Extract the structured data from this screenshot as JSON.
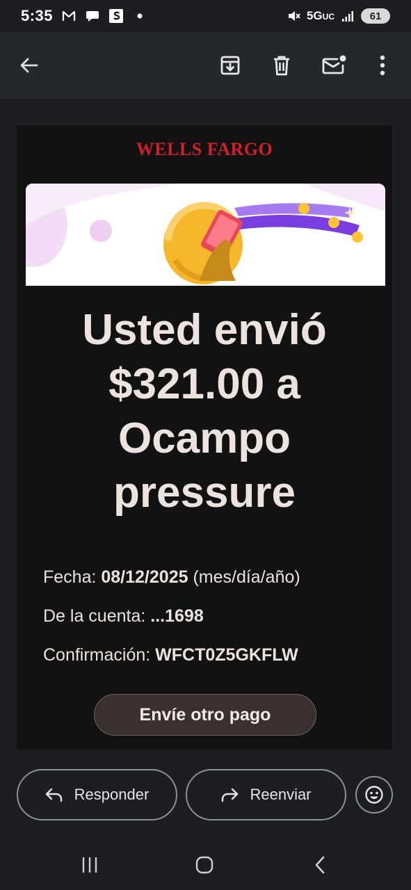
{
  "status_bar": {
    "time": "5:35",
    "network": "5G",
    "network_suffix": "UC",
    "battery": "61"
  },
  "toolbar": {
    "icons": [
      "back-arrow-icon",
      "archive-icon",
      "delete-icon",
      "mark-unread-icon",
      "more-vert-icon"
    ]
  },
  "email": {
    "brand": "WELLS FARGO",
    "headline_lines": [
      "Usted envió",
      "$321.00 a",
      "Ocampo",
      "pressure"
    ],
    "details": {
      "date_label": "Fecha: ",
      "date_value": "08/12/2025",
      "date_suffix": " (mes/día/año)",
      "account_label": "De la cuenta: ",
      "account_value": "...1698",
      "confirmation_label": "Confirmación: ",
      "confirmation_value": "WFCT0Z5GKFLW"
    },
    "cta_label": "Envíe otro pago"
  },
  "actions": {
    "reply_label": "Responder",
    "forward_label": "Reenviar"
  },
  "colors": {
    "brand_red": "#d21f28",
    "background": "#1c1e21",
    "card": "#121212"
  }
}
